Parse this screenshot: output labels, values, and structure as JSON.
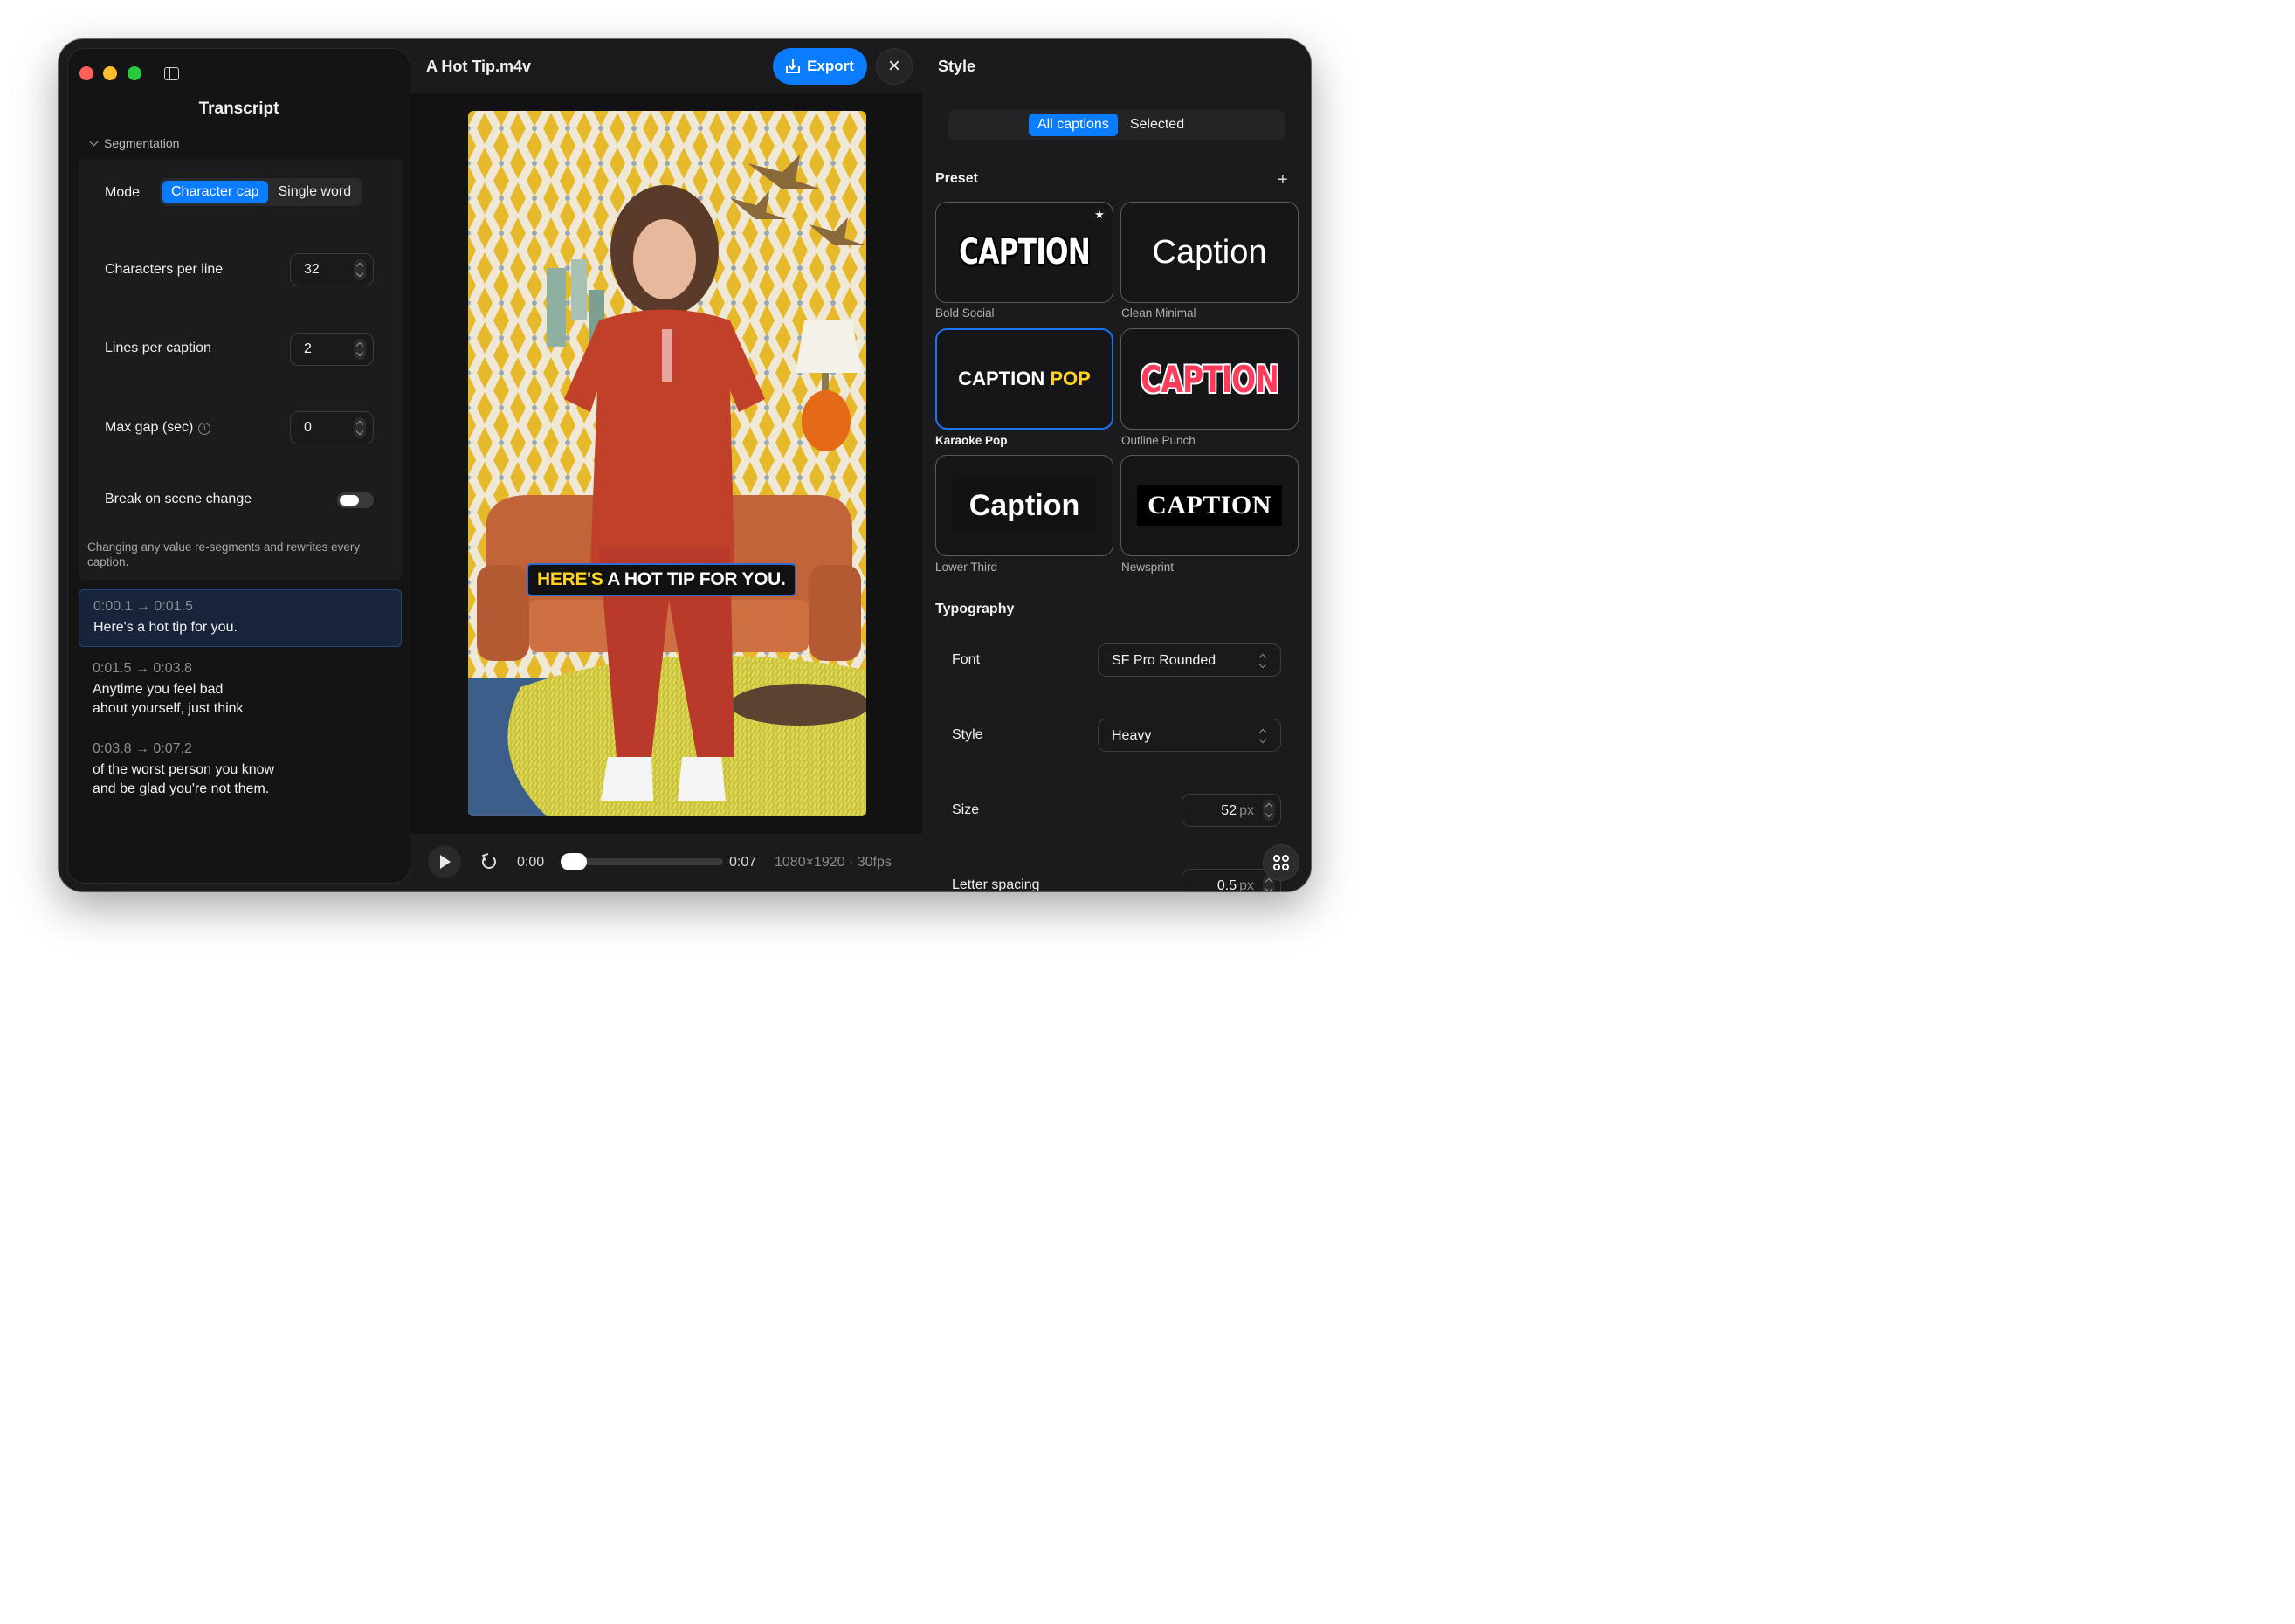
{
  "sidebar": {
    "title": "Transcript",
    "segmentation_label": "Segmentation",
    "mode": {
      "label": "Mode",
      "options": [
        "Character cap",
        "Single word"
      ],
      "selected": "Character cap"
    },
    "characters_per_line": {
      "label": "Characters per line",
      "value": "32"
    },
    "lines_per_caption": {
      "label": "Lines per caption",
      "value": "2"
    },
    "max_gap": {
      "label": "Max gap (sec)",
      "value": "0"
    },
    "break_on_scene_change": {
      "label": "Break on scene change",
      "on": false
    },
    "note": "Changing any value re-segments and rewrites every caption.",
    "captions": [
      {
        "time": "0:00.1 → 0:01.5",
        "text": "Here's a hot tip for you."
      },
      {
        "time": "0:01.5 → 0:03.8",
        "text": "Anytime you feel bad\nabout yourself, just think"
      },
      {
        "time": "0:03.8 → 0:07.2",
        "text": "of the worst person you know\nand be glad you're not them."
      }
    ]
  },
  "center": {
    "file_title": "A Hot Tip.m4v",
    "export_label": "Export",
    "close_label": "×",
    "caption_overlay": {
      "highlight": "HERE'S",
      "rest": " A HOT TIP FOR YOU."
    },
    "player": {
      "current": "0:00",
      "duration": "0:07",
      "meta": "1080×1920 · 30fps",
      "progress": 0
    }
  },
  "style_panel": {
    "title": "Style",
    "scope": {
      "options": [
        "All captions",
        "Selected"
      ],
      "selected": "All captions"
    },
    "preset_label": "Preset",
    "presets": [
      {
        "name": "Bold Social",
        "sample": "CAPTION",
        "favorite": true
      },
      {
        "name": "Clean Minimal",
        "sample": "Caption"
      },
      {
        "name": "Karaoke Pop",
        "sample": "CAPTION",
        "sample_highlight": "POP",
        "selected": true
      },
      {
        "name": "Outline Punch",
        "sample": "CAPTION"
      },
      {
        "name": "Lower Third",
        "sample": "Caption"
      },
      {
        "name": "Newsprint",
        "sample": "CAPTION"
      }
    ],
    "typography_label": "Typography",
    "font": {
      "label": "Font",
      "value": "SF Pro Rounded"
    },
    "style": {
      "label": "Style",
      "value": "Heavy"
    },
    "size": {
      "label": "Size",
      "value": "52",
      "unit": "px"
    },
    "letter_spacing": {
      "label": "Letter spacing",
      "value": "0.5",
      "unit": "px"
    }
  },
  "colors": {
    "accent": "#0a7cff",
    "highlight": "#ffd21f",
    "outline_punch": "#ff3b5c",
    "window_bg": "#1b1b1d"
  }
}
